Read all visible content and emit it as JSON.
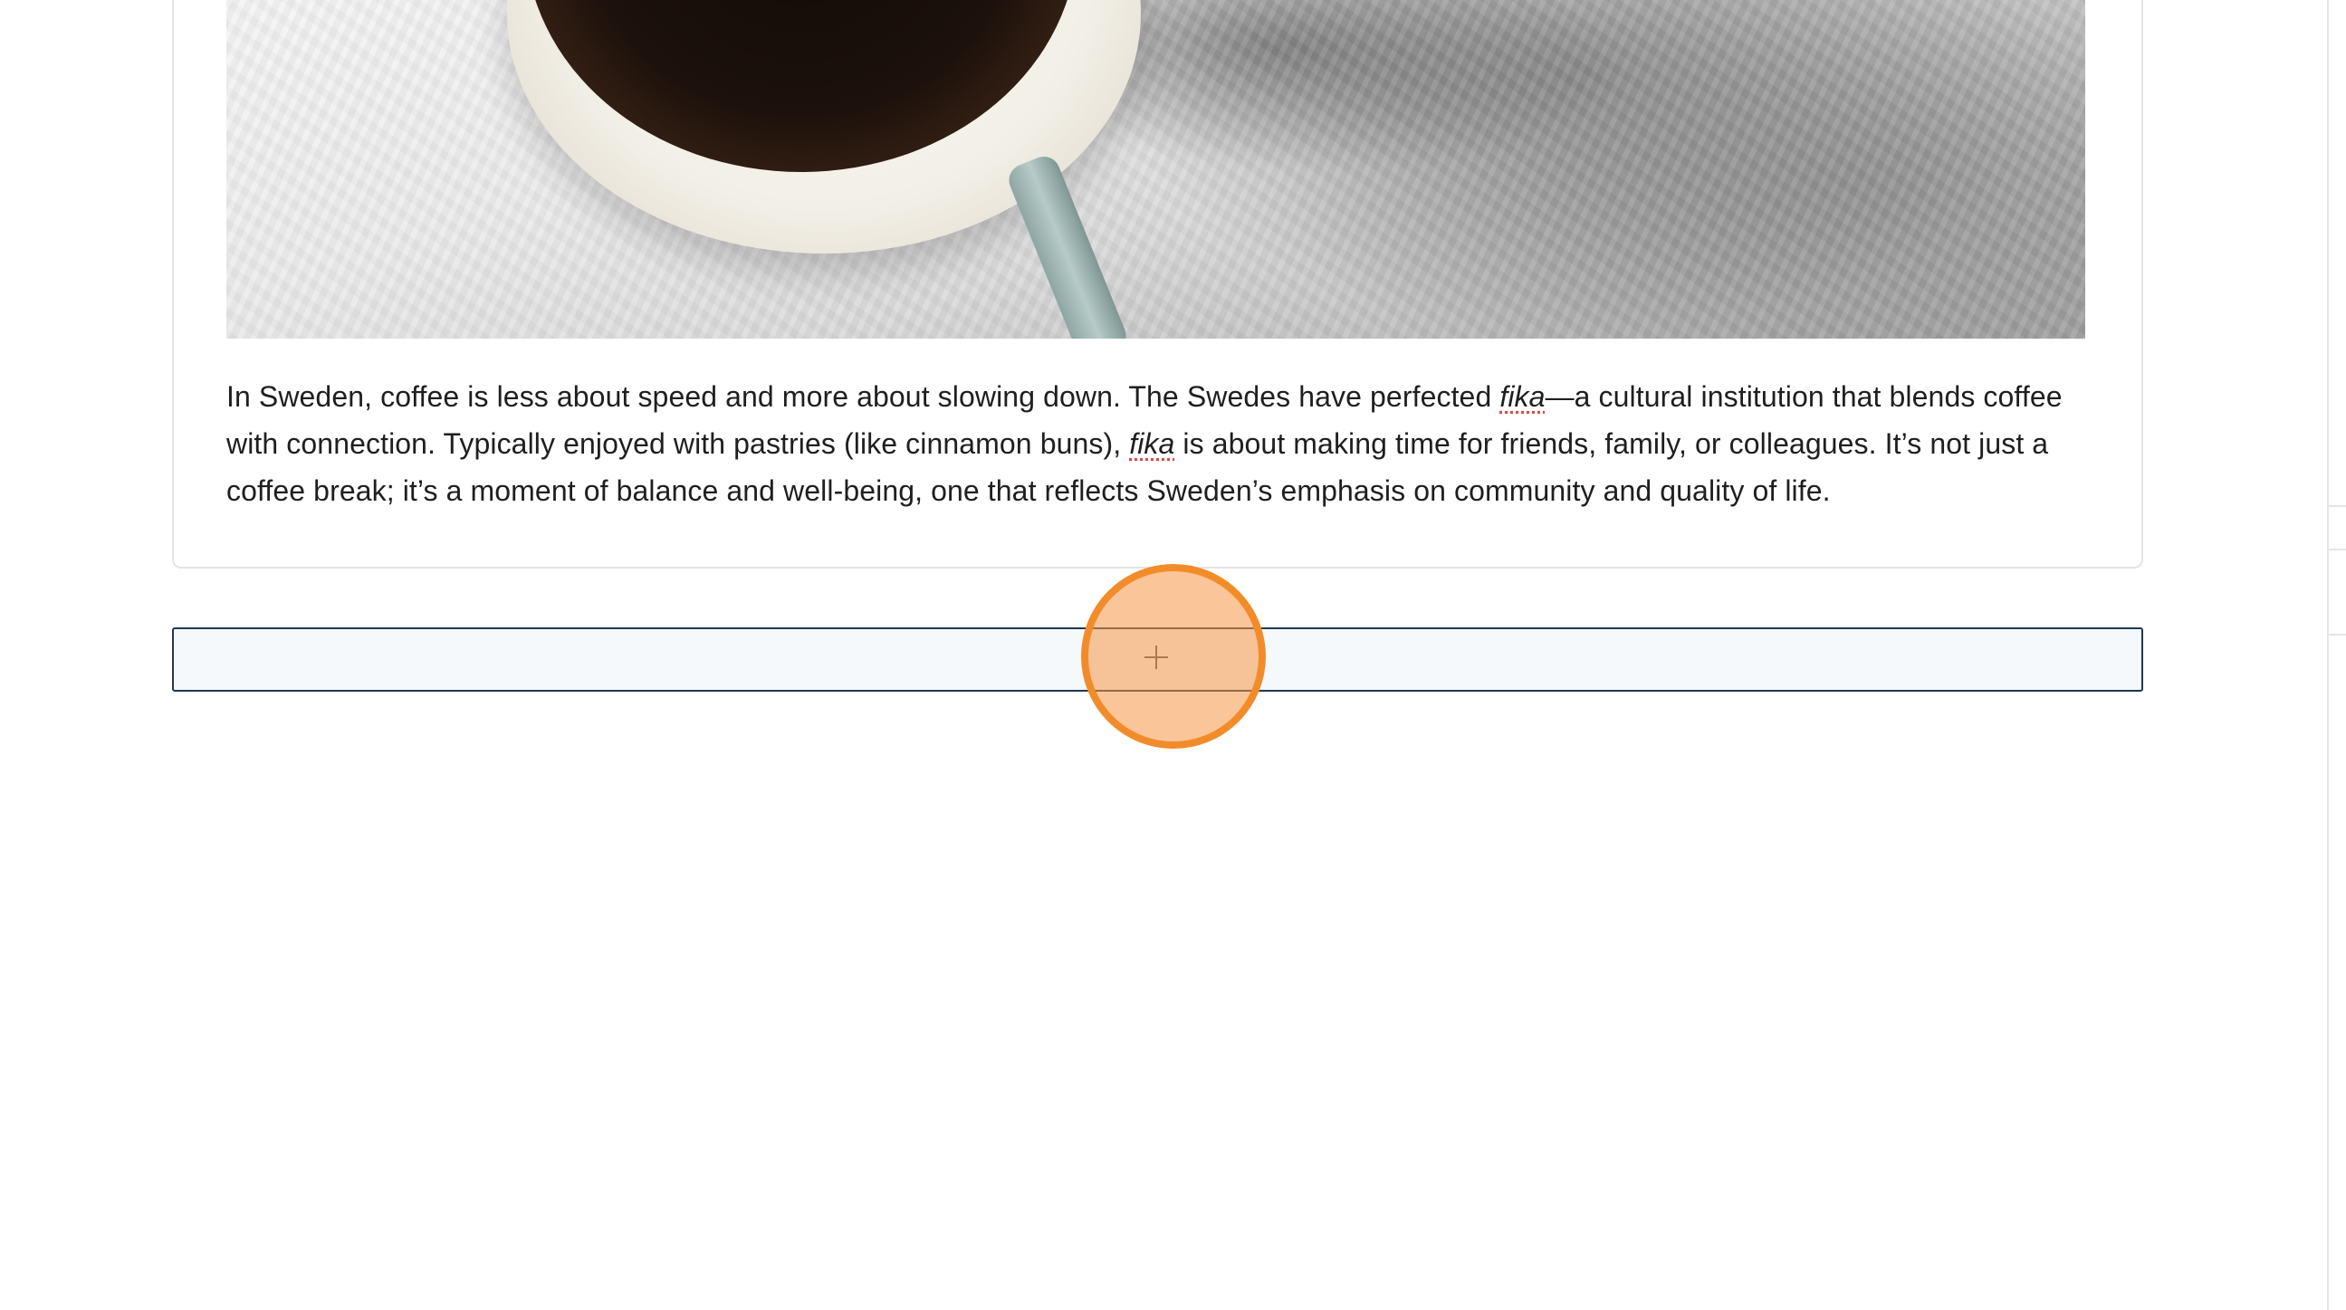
{
  "editor": {
    "image_block": {
      "alt_description": "coffee cup on textured white surface"
    },
    "paragraph": {
      "part1": "In Sweden, coffee is less about speed and more about slowing down. The Swedes have perfected ",
      "fika1": "fika",
      "part2": "—a cultural institution that blends coffee with connection. Typically enjoyed with pastries (like cinnamon buns), ",
      "fika2": "fika",
      "part3": " is about making time for friends, family, or colleagues. It’s not just a coffee break; it’s a moment of balance and well-being, one that reflects Sweden’s emphasis on community and quality of life."
    },
    "appender": {
      "icon": "plus-icon"
    }
  },
  "colors": {
    "appender_border": "#1e3a52",
    "appender_bg": "#f5f9fc",
    "click_highlight": "#f28c2a",
    "text": "#1f1f1f"
  }
}
